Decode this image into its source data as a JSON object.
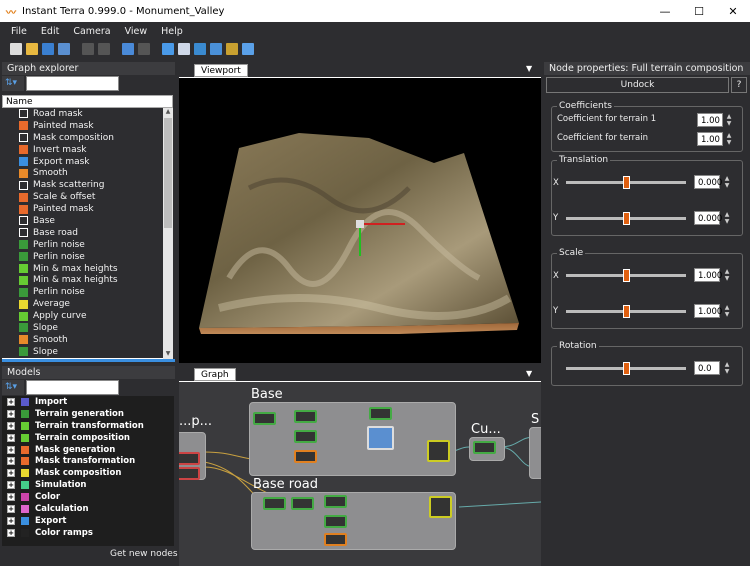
{
  "app": {
    "title": "Instant Terra 0.999.0 - Monument_Valley"
  },
  "menu": [
    "File",
    "Edit",
    "Camera",
    "View",
    "Help"
  ],
  "window_buttons": {
    "minimize": "—",
    "maximize": "☐",
    "close": "✕"
  },
  "graph_explorer": {
    "title": "Graph explorer",
    "column_header": "Name",
    "items": [
      {
        "label": "Road mask",
        "color": "#ffffff",
        "outline": true
      },
      {
        "label": "Painted mask",
        "color": "#e86a2c"
      },
      {
        "label": "Mask composition",
        "color": "#ffffff",
        "outline": true
      },
      {
        "label": "Invert mask",
        "color": "#e86a2c"
      },
      {
        "label": "Export mask",
        "color": "#3a8fe0"
      },
      {
        "label": "Smooth",
        "color": "#e88a2a"
      },
      {
        "label": "Mask scattering",
        "color": "#ffffff",
        "outline": true
      },
      {
        "label": "Scale & offset",
        "color": "#e86a2c"
      },
      {
        "label": "Painted mask",
        "color": "#e86a2c"
      },
      {
        "label": "Base",
        "color": "#ffffff",
        "outline": true
      },
      {
        "label": "Base road",
        "color": "#ffffff",
        "outline": true
      },
      {
        "label": "Perlin noise",
        "color": "#3a9a3a"
      },
      {
        "label": "Perlin noise",
        "color": "#3a9a3a"
      },
      {
        "label": "Min & max heights",
        "color": "#66cc33"
      },
      {
        "label": "Min & max heights",
        "color": "#66cc33"
      },
      {
        "label": "Perlin noise",
        "color": "#3a9a3a"
      },
      {
        "label": "Average",
        "color": "#e8d830"
      },
      {
        "label": "Apply curve",
        "color": "#66cc33"
      },
      {
        "label": "Slope",
        "color": "#3a9a3a"
      },
      {
        "label": "Smooth",
        "color": "#e88a2a"
      },
      {
        "label": "Slope",
        "color": "#3a9a3a"
      }
    ]
  },
  "models": {
    "title": "Models",
    "items": [
      {
        "label": "Import",
        "color": "#5a5acc"
      },
      {
        "label": "Terrain generation",
        "color": "#3a9a3a"
      },
      {
        "label": "Terrain transformation",
        "color": "#66cc33"
      },
      {
        "label": "Terrain composition",
        "color": "#66cc33"
      },
      {
        "label": "Mask generation",
        "color": "#e86a2c"
      },
      {
        "label": "Mask transformation",
        "color": "#e86a2c"
      },
      {
        "label": "Mask composition",
        "color": "#e8d830"
      },
      {
        "label": "Simulation",
        "color": "#44cc88"
      },
      {
        "label": "Color",
        "color": "#cc44aa"
      },
      {
        "label": "Calculation",
        "color": "#dd66cc"
      },
      {
        "label": "Export",
        "color": "#3a8fe0"
      },
      {
        "label": "Color ramps",
        "color": "#222222"
      }
    ],
    "footer_link": "Get new nodes"
  },
  "viewport": {
    "tab": "Viewport"
  },
  "graph": {
    "tab": "Graph",
    "groups": {
      "left": "...p...",
      "base": "Base",
      "base_road": "Base road",
      "cu": "Cu...",
      "s": "S"
    }
  },
  "properties": {
    "title": "Node properties: Full terrain composition",
    "undock": "Undock",
    "help": "?",
    "coefficients": {
      "legend": "Coefficients",
      "row1_label": "Coefficient for terrain 1",
      "row1_value": "1.00",
      "row2_label": "Coefficient for terrain",
      "row2_value": "1.00"
    },
    "translation": {
      "legend": "Translation",
      "x_label": "X",
      "x_value": "0.000",
      "x_level": 0.5,
      "y_label": "Y",
      "y_value": "0.000",
      "y_level": 0.5
    },
    "scale": {
      "legend": "Scale",
      "x_label": "X",
      "x_value": "1.000",
      "x_level": 0.5,
      "y_label": "Y",
      "y_value": "1.000",
      "y_level": 0.5
    },
    "rotation": {
      "legend": "Rotation",
      "value": "0.0",
      "level": 0.5
    }
  }
}
